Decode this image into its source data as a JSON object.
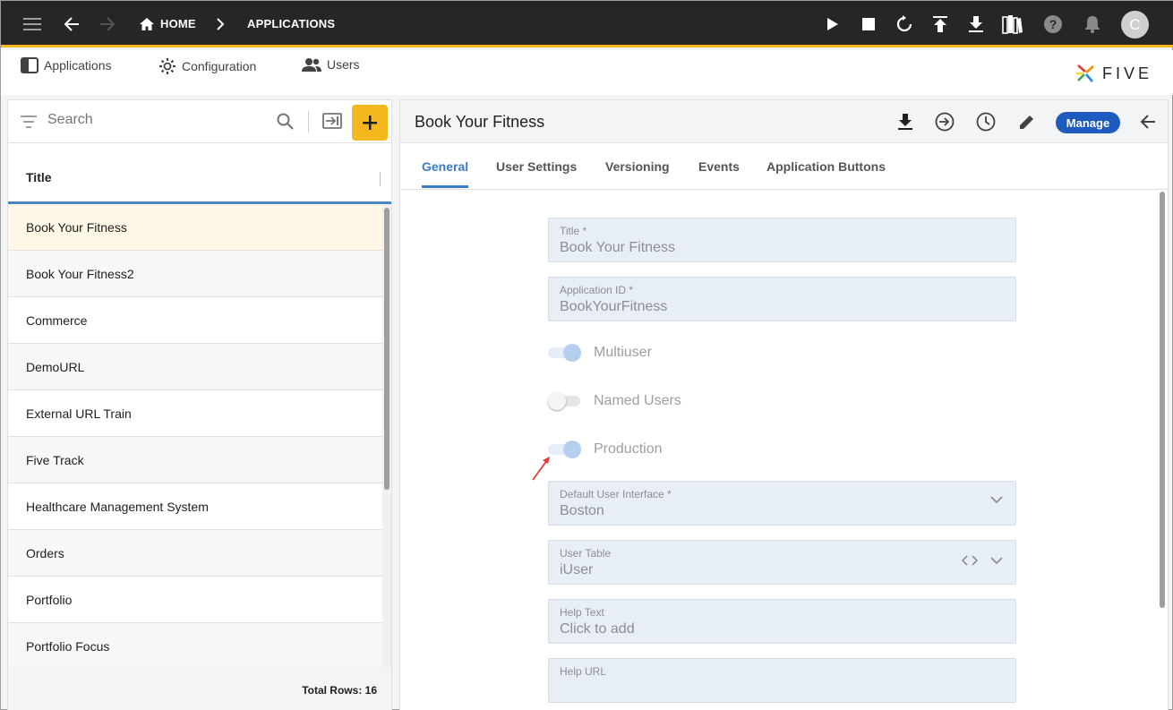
{
  "topbar": {
    "breadcrumb_home": "HOME",
    "breadcrumb_current": "APPLICATIONS",
    "avatar_initial": "C",
    "icons": [
      "menu-icon",
      "back-arrow-icon",
      "forward-arrow-icon",
      "home-icon",
      "chevron-right-icon",
      "play-icon",
      "stop-icon",
      "refresh-icon",
      "upload-icon",
      "download-icon",
      "library-icon",
      "help-icon",
      "bell-icon"
    ],
    "accent": "#f5b71e"
  },
  "subnav": {
    "items": [
      {
        "label": "Applications",
        "icon": "sidebar-icon"
      },
      {
        "label": "Configuration",
        "icon": "gear-icon"
      },
      {
        "label": "Users",
        "icon": "users-icon"
      }
    ],
    "logo_text": "FIVE"
  },
  "list": {
    "search_placeholder": "Search",
    "column_title": "Title",
    "rows": [
      "Book Your Fitness",
      "Book Your Fitness2",
      "Commerce",
      "DemoURL",
      "External URL Train",
      "Five Track",
      "Healthcare Management System",
      "Orders",
      "Portfolio",
      "Portfolio Focus"
    ],
    "selected_index": 0,
    "total_rows": "Total Rows: 16"
  },
  "detail": {
    "title": "Book Your Fitness",
    "manage_label": "Manage",
    "tabs": [
      "General",
      "User Settings",
      "Versioning",
      "Events",
      "Application Buttons"
    ],
    "active_tab": 0,
    "fields": {
      "title": {
        "label": "Title *",
        "value": "Book Your Fitness"
      },
      "app_id": {
        "label": "Application ID *",
        "value": "BookYourFitness"
      },
      "default_ui": {
        "label": "Default User Interface *",
        "value": "Boston"
      },
      "user_table": {
        "label": "User Table",
        "value": "iUser"
      },
      "help_text": {
        "label": "Help Text",
        "value": "Click to add"
      },
      "help_url": {
        "label": "Help URL",
        "value": ""
      }
    },
    "toggles": [
      {
        "label": "Multiuser",
        "on": true
      },
      {
        "label": "Named Users",
        "on": false
      },
      {
        "label": "Production",
        "on": true
      }
    ]
  }
}
